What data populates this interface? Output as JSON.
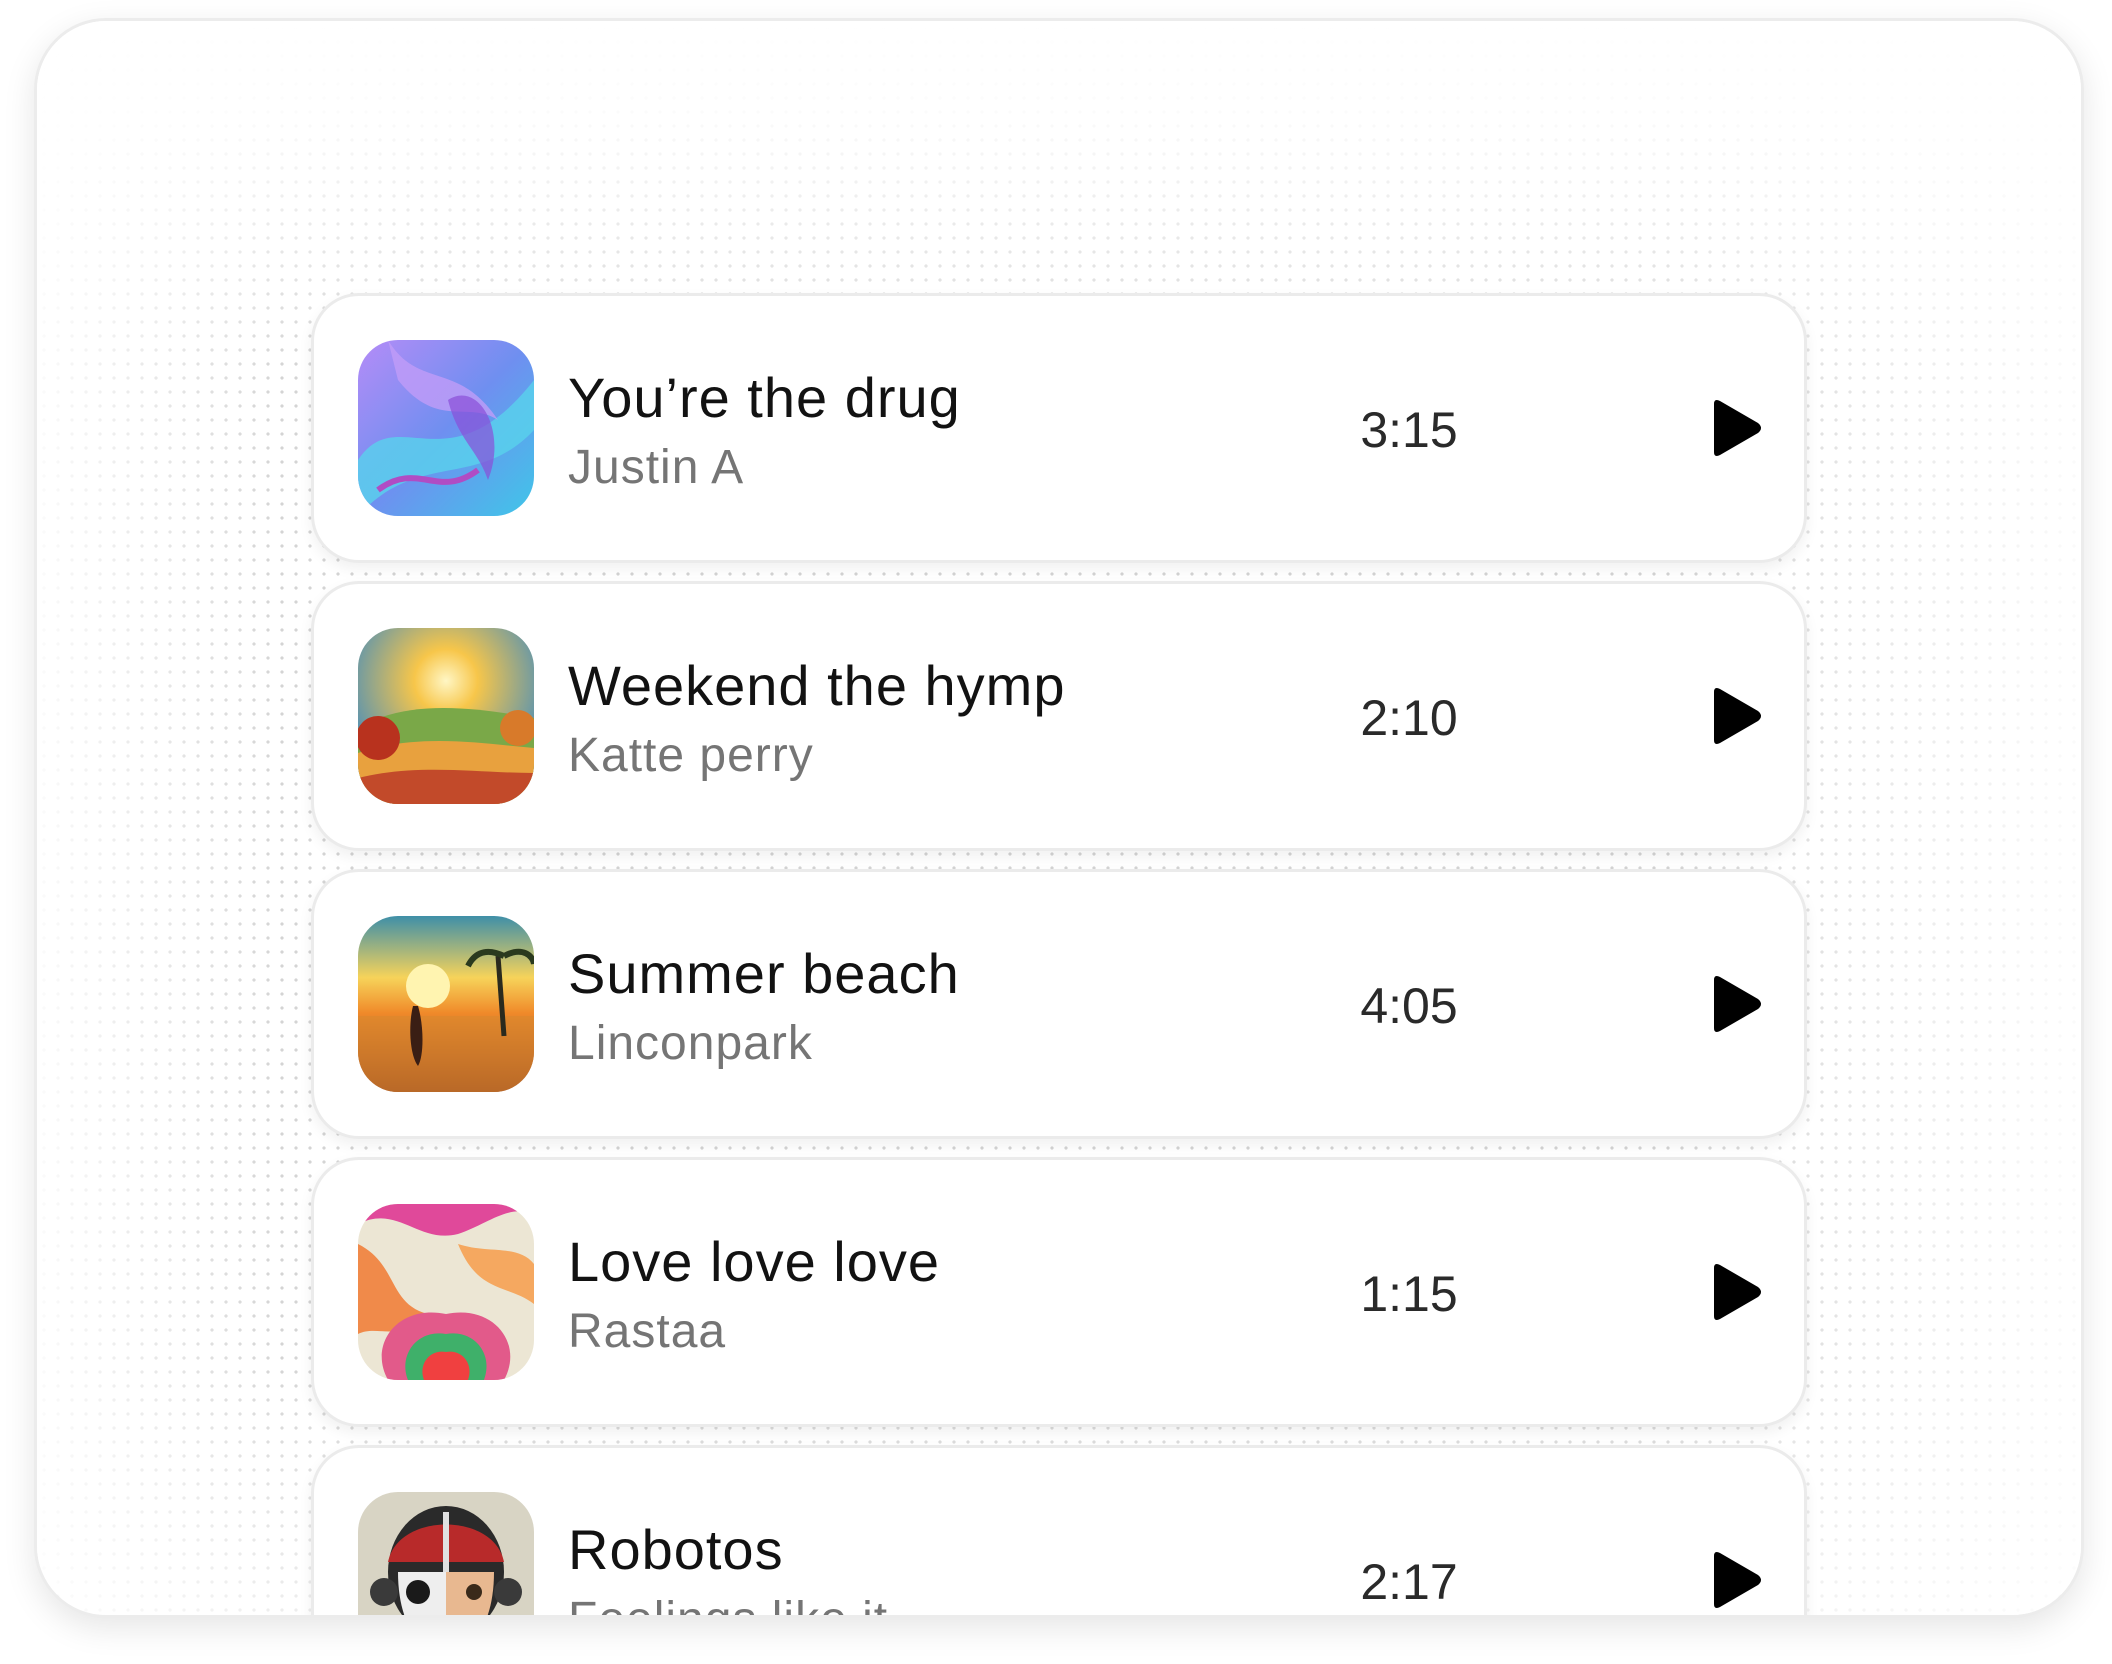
{
  "tracks": [
    {
      "title": "You’re the drug",
      "artist": "Justin A",
      "duration": "3:15",
      "cover": "abstract-purple-cover"
    },
    {
      "title": "Weekend the hymp",
      "artist": "Katte perry",
      "duration": "2:10",
      "cover": "sunset-hills-cover"
    },
    {
      "title": "Summer beach",
      "artist": "Linconpark",
      "duration": "4:05",
      "cover": "beach-sunset-cover"
    },
    {
      "title": "Love love love",
      "artist": "Rastaa",
      "duration": "1:15",
      "cover": "marbled-heart-cover"
    },
    {
      "title": "Robotos",
      "artist": "Feelings like it",
      "duration": "2:17",
      "cover": "robot-skull-cover"
    }
  ],
  "icons": {
    "play": "play-icon"
  },
  "colors": {
    "title": "#121212",
    "artist": "#757575",
    "duration": "#2a2a2a",
    "play": "#000000"
  }
}
